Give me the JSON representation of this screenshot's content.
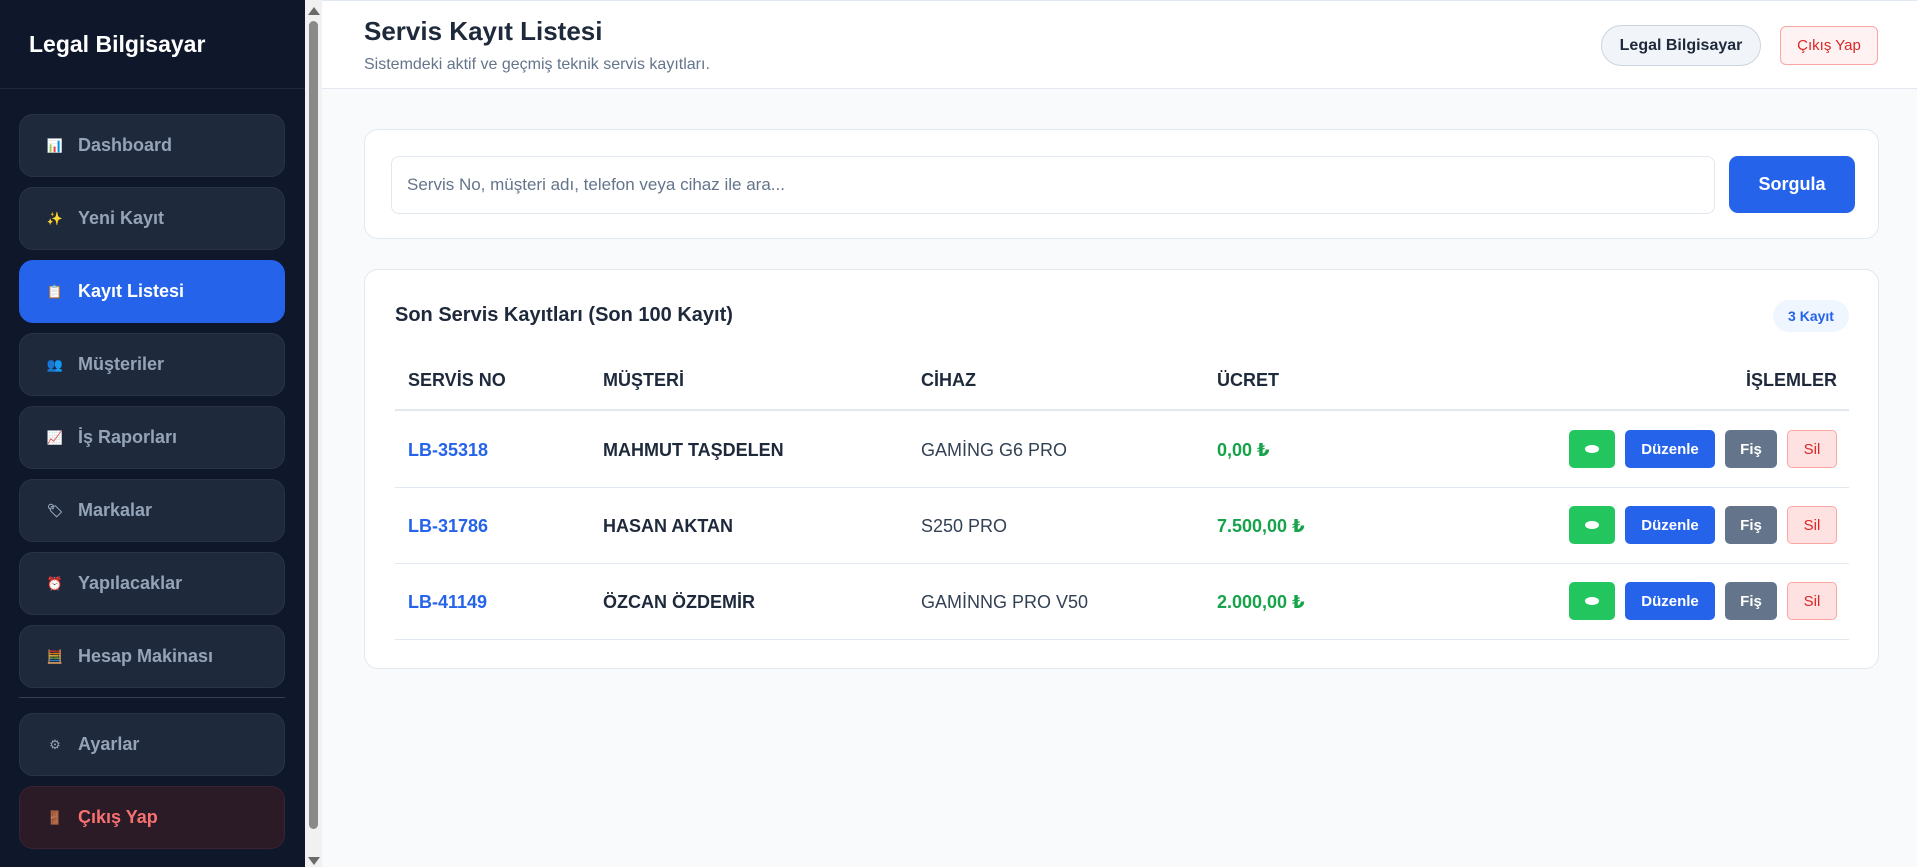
{
  "sidebar": {
    "brand": "Legal Bilgisayar",
    "items": [
      {
        "label": "Dashboard",
        "icon": "bar-chart-icon",
        "glyph": "📊"
      },
      {
        "label": "Yeni Kayıt",
        "icon": "sparkles-icon",
        "glyph": "✨"
      },
      {
        "label": "Kayıt Listesi",
        "icon": "clipboard-icon",
        "glyph": "📋"
      },
      {
        "label": "Müşteriler",
        "icon": "users-icon",
        "glyph": "👥"
      },
      {
        "label": "İş Raporları",
        "icon": "trend-chart-icon",
        "glyph": "📈"
      },
      {
        "label": "Markalar",
        "icon": "tag-icon",
        "glyph": "🏷"
      },
      {
        "label": "Yapılacaklar",
        "icon": "alarm-clock-icon",
        "glyph": "⏰"
      },
      {
        "label": "Hesap Makinası",
        "icon": "abacus-icon",
        "glyph": "🧮"
      }
    ],
    "settings": {
      "label": "Ayarlar",
      "icon": "gear-icon",
      "glyph": "⚙"
    },
    "logout": {
      "label": "Çıkış Yap",
      "icon": "door-icon",
      "glyph": "🚪"
    }
  },
  "header": {
    "title": "Servis Kayıt Listesi",
    "subtitle": "Sistemdeki aktif ve geçmiş teknik servis kayıtları.",
    "user": "Legal Bilgisayar",
    "logout": "Çıkış Yap"
  },
  "search": {
    "placeholder": "Servis No, müşteri adı, telefon veya cihaz ile ara...",
    "value": "",
    "button": "Sorgula"
  },
  "table": {
    "title": "Son Servis Kayıtları (Son 100 Kayıt)",
    "count": "3 Kayıt",
    "columns": [
      "SERVİS NO",
      "MÜŞTERİ",
      "CİHAZ",
      "ÜCRET",
      "İŞLEMLER"
    ],
    "rows": [
      {
        "no": "LB-35318",
        "customer": "MAHMUT TAŞDELEN",
        "device": "GAMİNG G6 PRO",
        "fee": "0,00 ₺"
      },
      {
        "no": "LB-31786",
        "customer": "HASAN AKTAN",
        "device": "S250 PRO",
        "fee": "7.500,00 ₺"
      },
      {
        "no": "LB-41149",
        "customer": "ÖZCAN ÖZDEMİR",
        "device": "GAMİNNG PRO V50",
        "fee": "2.000,00 ₺"
      }
    ],
    "actions": {
      "edit": "Düzenle",
      "slip": "Fiş",
      "delete": "Sil"
    }
  },
  "colors": {
    "accent": "#2563eb",
    "sidebar": "#0f172a",
    "success": "#16a34a",
    "danger": "#dc2626"
  }
}
